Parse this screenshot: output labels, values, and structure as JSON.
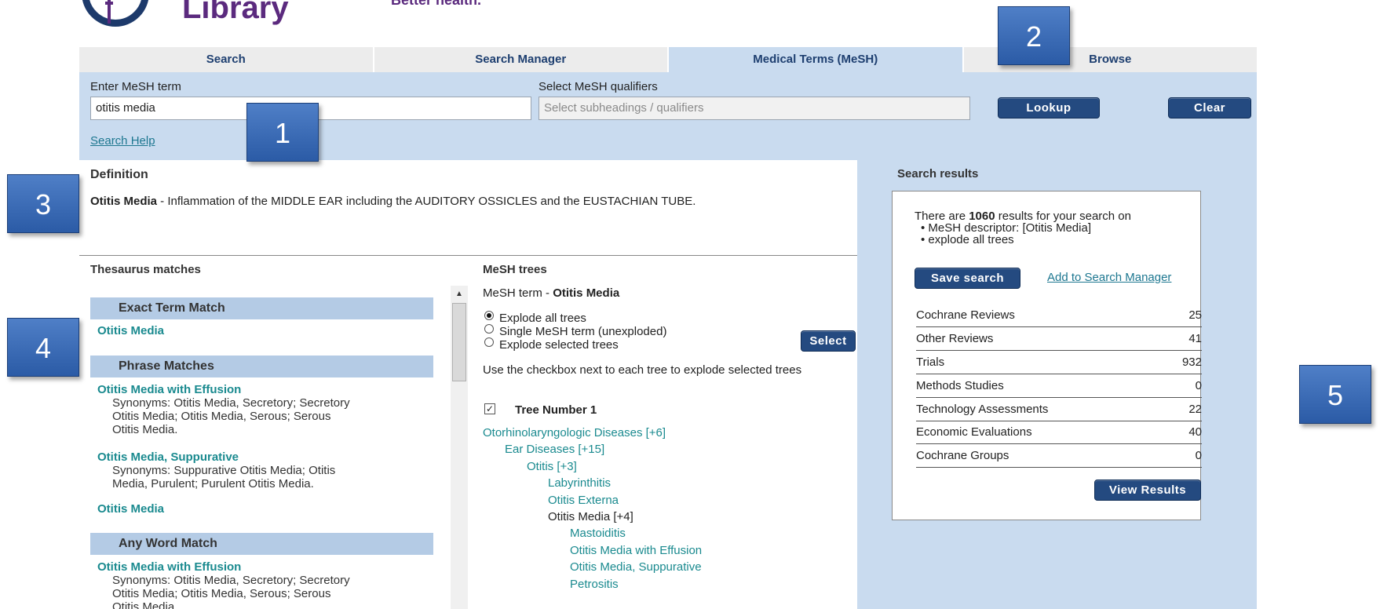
{
  "header": {
    "logo_text": "Library",
    "tagline": "Better health."
  },
  "tabs": [
    {
      "label": "Search",
      "active": false
    },
    {
      "label": "Search Manager",
      "active": false
    },
    {
      "label": "Medical Terms (MeSH)",
      "active": true
    },
    {
      "label": "Browse",
      "active": false
    }
  ],
  "search_form": {
    "mesh_term_label": "Enter MeSH term",
    "mesh_term_value": "otitis media",
    "qualifiers_label": "Select MeSH qualifiers",
    "qualifiers_placeholder": "Select subheadings / qualifiers",
    "lookup_label": "Lookup",
    "clear_label": "Clear",
    "search_help": "Search Help"
  },
  "definition": {
    "title": "Definition",
    "term": "Otitis Media",
    "text": " - Inflammation of the MIDDLE EAR including the AUDITORY OSSICLES and the EUSTACHIAN TUBE."
  },
  "thesaurus": {
    "title": "Thesaurus matches",
    "exact_header": "Exact Term Match",
    "exact_items": [
      "Otitis Media"
    ],
    "phrase_header": "Phrase Matches",
    "phrase_items": [
      {
        "term": "Otitis Media with Effusion",
        "syn1": "Synonyms: Otitis Media, Secretory; Secretory",
        "syn2": "Otitis Media; Otitis Media, Serous; Serous",
        "syn3": "Otitis Media."
      },
      {
        "term": "Otitis Media, Suppurative",
        "syn1": "Synonyms: Suppurative Otitis Media; Otitis",
        "syn2": "Media, Purulent; Purulent Otitis Media."
      },
      {
        "term": "Otitis Media"
      }
    ],
    "anyword_header": "Any Word Match",
    "anyword_items": [
      {
        "term": "Otitis Media with Effusion",
        "syn1": "Synonyms: Otitis Media, Secretory; Secretory",
        "syn2": "Otitis Media; Otitis Media, Serous; Serous",
        "syn3": "Otitis Media."
      }
    ]
  },
  "mesh_trees": {
    "title": "MeSH trees",
    "term_prefix": "MeSH term - ",
    "term": "Otitis Media",
    "options": [
      "Explode all trees",
      "Single MeSH term (unexploded)",
      "Explode selected trees"
    ],
    "selected_option": 0,
    "select_label": "Select",
    "instruction": "Use the checkbox next to each tree to explode selected trees",
    "tree_number_label": "Tree Number 1",
    "tree": [
      {
        "label": "Otorhinolaryngologic Diseases [+6]",
        "link": true
      },
      {
        "label": "Ear Diseases [+15]",
        "link": true
      },
      {
        "label": "Otitis [+3]",
        "link": true
      },
      {
        "label": "Labyrinthitis",
        "link": true
      },
      {
        "label": "Otitis Externa",
        "link": true
      },
      {
        "label": "Otitis Media [+4]",
        "link": false
      },
      {
        "label": "Mastoiditis",
        "link": true
      },
      {
        "label": "Otitis Media with Effusion",
        "link": true
      },
      {
        "label": "Otitis Media, Suppurative",
        "link": true
      },
      {
        "label": "Petrositis",
        "link": true
      }
    ]
  },
  "results": {
    "title": "Search results",
    "intro_prefix": "There are ",
    "count": "1060",
    "intro_suffix": " results for your search on",
    "bullet1": "MeSH descriptor: [Otitis Media]",
    "bullet2": "explode all trees",
    "save_search_label": "Save search",
    "add_manager_label": "Add to Search Manager",
    "rows": [
      {
        "label": "Cochrane Reviews",
        "value": "25"
      },
      {
        "label": "Other Reviews",
        "value": "41"
      },
      {
        "label": "Trials",
        "value": "932"
      },
      {
        "label": "Methods Studies",
        "value": "0"
      },
      {
        "label": "Technology Assessments",
        "value": "22"
      },
      {
        "label": "Economic Evaluations",
        "value": "40"
      },
      {
        "label": "Cochrane Groups",
        "value": "0"
      }
    ],
    "view_results_label": "View Results"
  },
  "callouts": [
    "1",
    "2",
    "3",
    "4",
    "5"
  ],
  "colors": {
    "brand_navy": "#1d3a6b",
    "brand_purple": "#5b2a7e",
    "panel_blue": "#c9dbef",
    "button_blue": "#244a80",
    "link_teal": "#1a8a8f",
    "callout_blue": "#3a6ab5"
  }
}
